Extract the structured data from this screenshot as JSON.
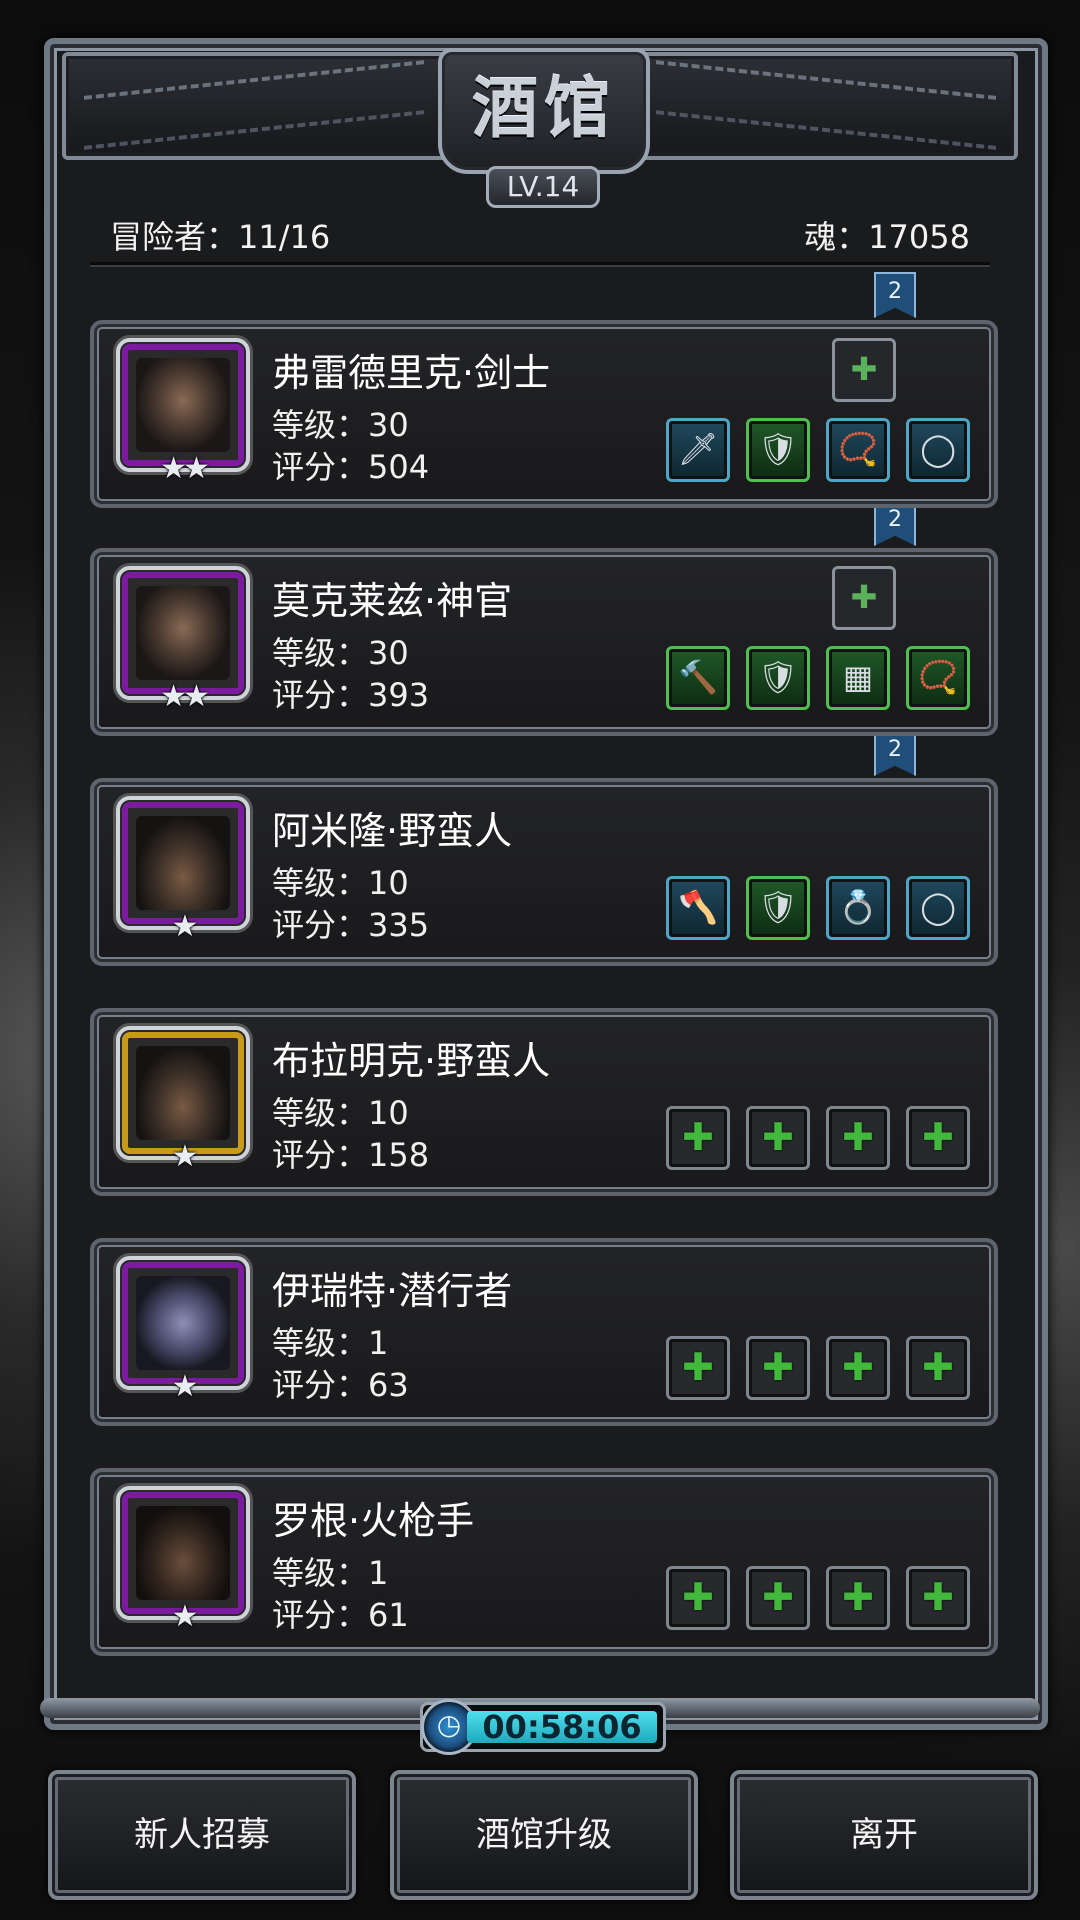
{
  "header": {
    "title": "酒馆",
    "level_badge": "LV.14"
  },
  "info": {
    "adventurers": "冒险者：11/16",
    "souls": "魂：17058"
  },
  "heroes": [
    {
      "name": "弗雷德里克·剑士",
      "level": "等级：30",
      "score": "评分：504",
      "stars": "★★",
      "frame": "purple",
      "ribbon": "2",
      "equipment": [
        {
          "icon": "sword-icon",
          "glyph": "🗡",
          "quality": "blue"
        },
        {
          "icon": "chest-armor-icon",
          "glyph": "🛡",
          "quality": "green"
        },
        {
          "icon": "necklace-icon",
          "glyph": "📿",
          "quality": "blue"
        },
        {
          "icon": "ring-icon",
          "glyph": "◯",
          "quality": "blue"
        }
      ]
    },
    {
      "name": "莫克莱兹·神官",
      "level": "等级：30",
      "score": "评分：393",
      "stars": "★★",
      "frame": "purple",
      "ribbon": "2",
      "equipment": [
        {
          "icon": "hammer-icon",
          "glyph": "🔨",
          "quality": "green"
        },
        {
          "icon": "chest-armor-icon",
          "glyph": "🛡",
          "quality": "green"
        },
        {
          "icon": "leather-belt-icon",
          "glyph": "▦",
          "quality": "green"
        },
        {
          "icon": "necklace-icon",
          "glyph": "📿",
          "quality": "green"
        }
      ]
    },
    {
      "name": "阿米隆·野蛮人",
      "level": "等级：10",
      "score": "评分：335",
      "stars": "★",
      "frame": "purple",
      "ribbon": "2",
      "equipment": [
        {
          "icon": "axe-icon",
          "glyph": "🪓",
          "quality": "blue"
        },
        {
          "icon": "chest-armor-icon",
          "glyph": "🛡",
          "quality": "green"
        },
        {
          "icon": "sapphire-ring-icon",
          "glyph": "💍",
          "quality": "blue"
        },
        {
          "icon": "ring-icon",
          "glyph": "◯",
          "quality": "blue"
        }
      ]
    },
    {
      "name": "布拉明克·野蛮人",
      "level": "等级：10",
      "score": "评分：158",
      "stars": "★",
      "frame": "gold",
      "equipment": [
        {
          "icon": "add-weapon-icon",
          "glyph": "✚",
          "quality": "empty"
        },
        {
          "icon": "add-armor-icon",
          "glyph": "✚",
          "quality": "empty"
        },
        {
          "icon": "add-accessory-icon",
          "glyph": "✚",
          "quality": "empty"
        },
        {
          "icon": "add-accessory-icon",
          "glyph": "✚",
          "quality": "empty"
        }
      ]
    },
    {
      "name": "伊瑞特·潜行者",
      "level": "等级：1",
      "score": "评分：63",
      "stars": "★",
      "frame": "purple",
      "equipment": [
        {
          "icon": "add-weapon-icon",
          "glyph": "✚",
          "quality": "empty"
        },
        {
          "icon": "add-armor-icon",
          "glyph": "✚",
          "quality": "empty"
        },
        {
          "icon": "add-accessory-icon",
          "glyph": "✚",
          "quality": "empty"
        },
        {
          "icon": "add-accessory-icon",
          "glyph": "✚",
          "quality": "empty"
        }
      ]
    },
    {
      "name": "罗根·火枪手",
      "level": "等级：1",
      "score": "评分：61",
      "stars": "★",
      "frame": "purple",
      "equipment": [
        {
          "icon": "add-weapon-icon",
          "glyph": "✚",
          "quality": "empty"
        },
        {
          "icon": "add-armor-icon",
          "glyph": "✚",
          "quality": "empty"
        },
        {
          "icon": "add-accessory-icon",
          "glyph": "✚",
          "quality": "empty"
        },
        {
          "icon": "add-accessory-icon",
          "glyph": "✚",
          "quality": "empty"
        }
      ]
    }
  ],
  "timer": "00:58:06",
  "buttons": {
    "recruit": "新人招募",
    "upgrade": "酒馆升级",
    "leave": "离开"
  },
  "colors": {
    "purple_frame": "#7d1ba0",
    "gold_frame": "#c79a1c",
    "timer_fill": "#3cc6d8",
    "ribbon": "#1f4e78"
  }
}
